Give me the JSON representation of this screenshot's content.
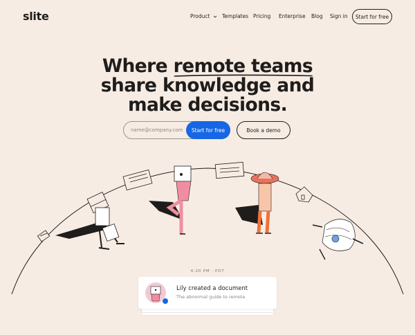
{
  "nav": {
    "logo": "slite",
    "items": [
      {
        "label": "Product",
        "has_dropdown": true
      },
      {
        "label": "Templates"
      },
      {
        "label": "Pricing"
      },
      {
        "label": "Enterprise"
      },
      {
        "label": "Blog"
      },
      {
        "label": "Sign in"
      }
    ],
    "cta_label": "Start for free"
  },
  "hero": {
    "title_line1_prefix": "Where ",
    "title_line1_highlight": "remote teams",
    "title_line2": "share knowledge and",
    "title_line3": "make decisions.",
    "email_placeholder": "name@company.com",
    "primary_cta": "Start for free",
    "secondary_cta": "Book a demo"
  },
  "activity": {
    "time": "4:20 PM · PDT",
    "title": "Lily created a document",
    "subtitle": "The abnormal guide to remote"
  },
  "colors": {
    "background": "#f7ece4",
    "accent": "#1667e5",
    "text": "#1f1d1b"
  }
}
